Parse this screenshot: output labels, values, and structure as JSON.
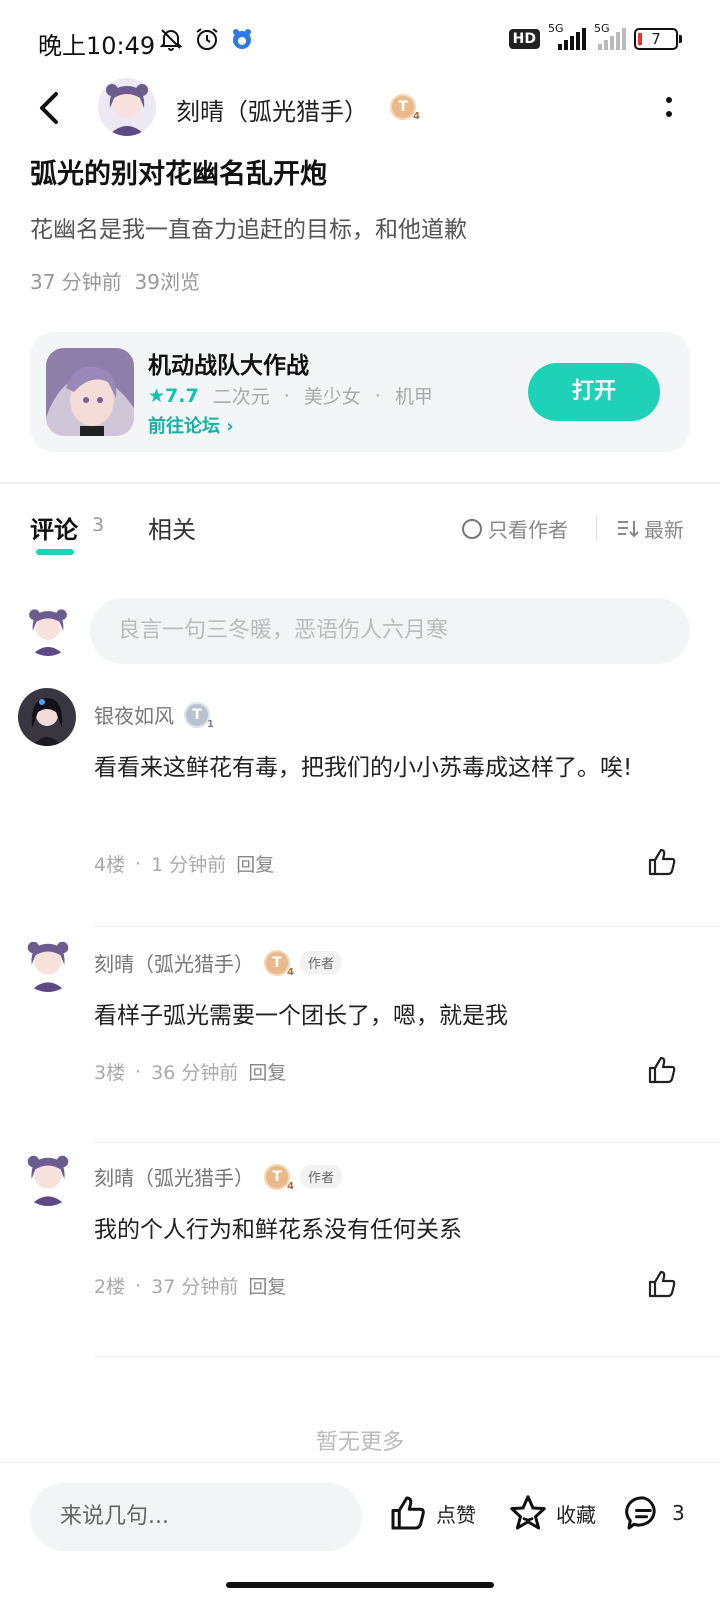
{
  "status_bar": {
    "time": "晚上10:49",
    "hd": "HD",
    "sig1": "5G",
    "sig2": "5G",
    "battery": "7"
  },
  "header": {
    "author_name": "刻晴（弧光猎手）",
    "badge_letter": "T",
    "badge_level": "4"
  },
  "post": {
    "title": "弧光的别对花幽名乱开炮",
    "body": "花幽名是我一直奋力追赶的目标，和他道歉",
    "time": "37 分钟前",
    "views": "39浏览"
  },
  "game_card": {
    "name": "机动战队大作战",
    "score": "★7.7",
    "tags": [
      "二次元",
      "·",
      "美少女",
      "·",
      "机甲"
    ],
    "link": "前往论坛 ›",
    "button": "打开"
  },
  "tabs": {
    "comments_label": "评论",
    "comments_count": "3",
    "related_label": "相关",
    "only_author": "只看作者",
    "sort": "最新"
  },
  "comment_input_placeholder": "良言一句三冬暖，恶语伤人六月寒",
  "comments": [
    {
      "name": "银夜如风",
      "badge_letter": "T",
      "badge_level": "1",
      "text": "看看来这鲜花有毒，把我们的小小苏毒成这样了。唉!",
      "floor": "4楼",
      "dot": "·",
      "time": "1 分钟前",
      "reply": "回复"
    },
    {
      "name": "刻晴（弧光猎手）",
      "badge_letter": "T",
      "badge_level": "4",
      "author_tag": "作者",
      "text": "看样子弧光需要一个团长了，嗯，就是我",
      "floor": "3楼",
      "dot": "·",
      "time": "36 分钟前",
      "reply": "回复"
    },
    {
      "name": "刻晴（弧光猎手）",
      "badge_letter": "T",
      "badge_level": "4",
      "author_tag": "作者",
      "text": "我的个人行为和鲜花系没有任何关系",
      "floor": "2楼",
      "dot": "·",
      "time": "37 分钟前",
      "reply": "回复"
    }
  ],
  "no_more": "暂无更多",
  "bottom_bar": {
    "placeholder": "来说几句...",
    "like": "点赞",
    "favorite": "收藏",
    "comment_count": "3"
  },
  "colors": {
    "accent": "#1fd1b7",
    "accent_text": "#14b3a3",
    "coin_gold": "#e9b98a",
    "coin_silver": "#b9c2cf"
  }
}
